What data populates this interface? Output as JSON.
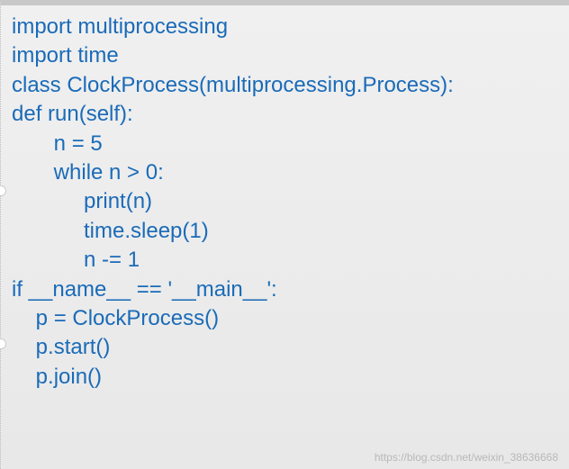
{
  "code": {
    "l1": "import multiprocessing",
    "l2": "import time",
    "l3": "class ClockProcess(multiprocessing.Process):",
    "l4": "def run(self):",
    "l5": "       n = 5",
    "l6": "       while n > 0:",
    "l7": "            print(n)",
    "l8": "            time.sleep(1)",
    "l9": "            n -= 1",
    "l10": "if __name__ == '__main__':",
    "l11": "    p = ClockProcess()",
    "l12": "    p.start()",
    "l13": "    p.join()"
  },
  "watermark": "https://blog.csdn.net/weixin_38636668"
}
